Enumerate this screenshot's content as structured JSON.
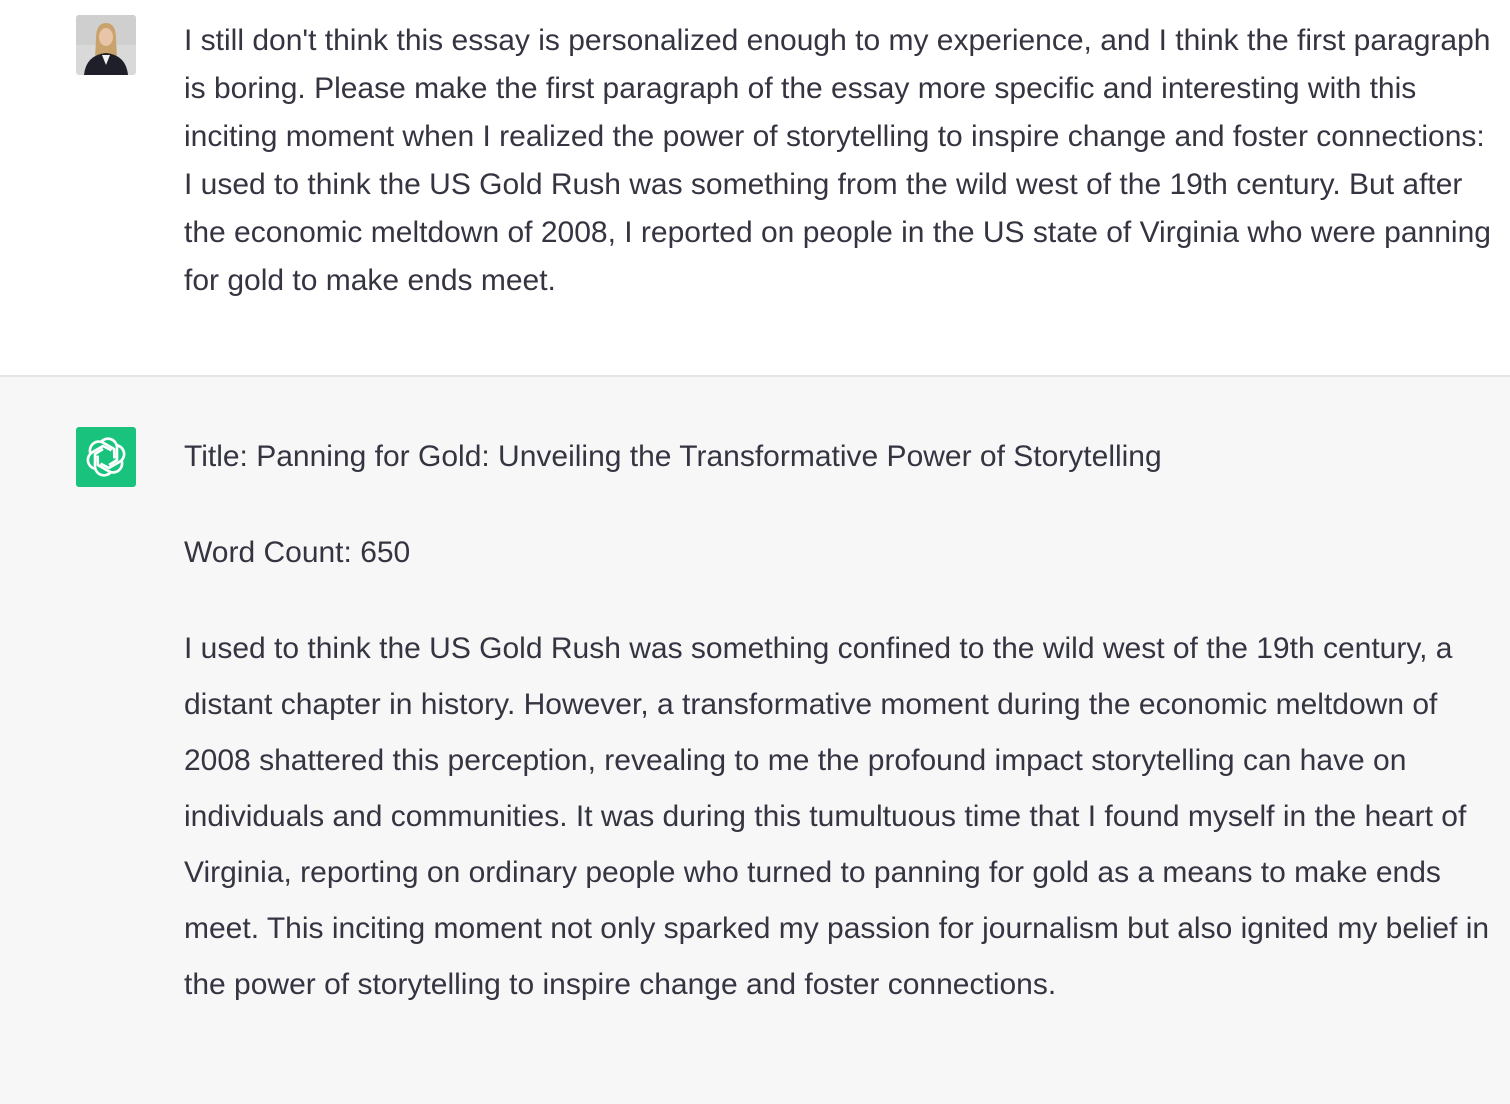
{
  "conversation": {
    "user_message": {
      "avatar": "user-avatar-photo",
      "text": "I still don't think this essay is personalized enough to my experience, and I think the first paragraph is boring. Please make the first paragraph of the essay more specific and interesting with this inciting moment when I realized the power of storytelling to inspire change and foster connections: I used to think the US Gold Rush was something from the wild west of the 19th century. But after the economic meltdown of 2008, I reported on people in the US state of Virginia who were panning for gold to make ends meet."
    },
    "assistant_message": {
      "avatar": "openai-logo-icon",
      "avatar_color": "#19c37d",
      "title": "Title: Panning for Gold: Unveiling the Transformative Power of Storytelling",
      "word_count": "Word Count: 650",
      "paragraph": "I used to think the US Gold Rush was something confined to the wild west of the 19th century, a distant chapter in history. However, a transformative moment during the economic meltdown of 2008 shattered this perception, revealing to me the profound impact storytelling can have on individuals and communities. It was during this tumultuous time that I found myself in the heart of Virginia, reporting on ordinary people who turned to panning for gold as a means to make ends meet. This inciting moment not only sparked my passion for journalism but also ignited my belief in the power of storytelling to inspire change and foster connections."
    }
  }
}
